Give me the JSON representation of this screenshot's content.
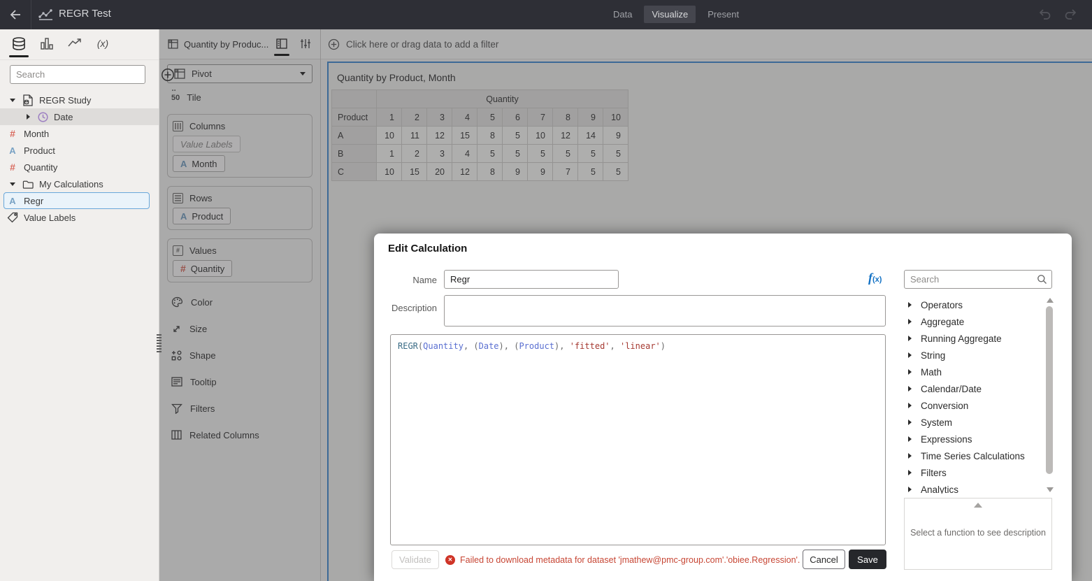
{
  "topbar": {
    "title": "REGR Test",
    "tabs": [
      {
        "label": "Data"
      },
      {
        "label": "Visualize"
      },
      {
        "label": "Present"
      }
    ],
    "icons": [
      "back-arrow",
      "workbook-chart",
      "undo",
      "redo"
    ]
  },
  "data_panel": {
    "nav_icons": [
      "data",
      "visualizations",
      "analytics",
      "calculations-fx"
    ],
    "search_placeholder": "Search",
    "add_icon": "circled-plus",
    "tree": [
      {
        "label": "REGR Study",
        "icon": "dataset",
        "level": 0,
        "expanded": true
      },
      {
        "label": "Date",
        "icon": "clock-date",
        "level": 1,
        "collapsed": true,
        "highlighted": true
      },
      {
        "label": "Month",
        "icon": "number-attribute",
        "level": 1
      },
      {
        "label": "Product",
        "icon": "text-attribute",
        "level": 1
      },
      {
        "label": "Quantity",
        "icon": "number-attribute",
        "level": 1
      },
      {
        "label": "My Calculations",
        "icon": "folder",
        "level": 0,
        "expanded": true
      },
      {
        "label": "Regr",
        "icon": "text-attribute",
        "level": 1,
        "selected": true
      },
      {
        "label": "Value Labels",
        "icon": "tag",
        "level": 0
      }
    ]
  },
  "grammar_panel": {
    "tab_label": "Quantity by Produc...",
    "tab_icons": [
      "pivot-grid",
      "grammar-panel",
      "properties-sliders"
    ],
    "viz_type_label": "Pivot",
    "tile_label": "Tile",
    "sections": [
      {
        "label": "Columns",
        "pills": [
          {
            "label": "Value Labels",
            "placeholder": true
          },
          {
            "label": "Month",
            "glyph": "A"
          }
        ]
      },
      {
        "label": "Rows",
        "pills": [
          {
            "label": "Product",
            "glyph": "A"
          }
        ]
      },
      {
        "label": "Values",
        "pills": [
          {
            "label": "Quantity",
            "glyph": "#"
          }
        ]
      }
    ],
    "extras": [
      "Color",
      "Size",
      "Shape",
      "Tooltip",
      "Filters",
      "Related Columns"
    ]
  },
  "canvas": {
    "filter_prompt": "Click here or drag data to add a filter",
    "viz_title": "Quantity by Product, Month",
    "table": {
      "group_header": "Quantity",
      "row_header": "Product",
      "columns": [
        "1",
        "2",
        "3",
        "4",
        "5",
        "6",
        "7",
        "8",
        "9",
        "10"
      ],
      "rows": [
        {
          "label": "A",
          "values": [
            10,
            11,
            12,
            15,
            8,
            5,
            10,
            12,
            14,
            9
          ]
        },
        {
          "label": "B",
          "values": [
            1,
            2,
            3,
            4,
            5,
            5,
            5,
            5,
            5,
            5
          ]
        },
        {
          "label": "C",
          "values": [
            10,
            15,
            20,
            12,
            8,
            9,
            9,
            7,
            5,
            5
          ]
        }
      ]
    }
  },
  "dialog": {
    "title": "Edit Calculation",
    "name_label": "Name",
    "name_value": "Regr",
    "description_label": "Description",
    "description_value": "",
    "fx_icon": "f(x)",
    "formula_tokens": [
      {
        "text": "REGR",
        "type": "function"
      },
      {
        "text": "(",
        "type": "punct"
      },
      {
        "text": "Quantity",
        "type": "column"
      },
      {
        "text": ", ",
        "type": "punct"
      },
      {
        "text": "(",
        "type": "punct"
      },
      {
        "text": "Date",
        "type": "column"
      },
      {
        "text": ")",
        "type": "punct"
      },
      {
        "text": ", ",
        "type": "punct"
      },
      {
        "text": "(",
        "type": "punct"
      },
      {
        "text": "Product",
        "type": "column"
      },
      {
        "text": ")",
        "type": "punct"
      },
      {
        "text": ", ",
        "type": "punct"
      },
      {
        "text": "'fitted'",
        "type": "string"
      },
      {
        "text": ", ",
        "type": "punct"
      },
      {
        "text": "'linear'",
        "type": "string"
      },
      {
        "text": ")",
        "type": "punct"
      }
    ],
    "functions": {
      "search_placeholder": "Search",
      "categories": [
        "Operators",
        "Aggregate",
        "Running Aggregate",
        "String",
        "Math",
        "Calendar/Date",
        "Conversion",
        "System",
        "Expressions",
        "Time Series Calculations",
        "Filters",
        "Analytics"
      ],
      "description_placeholder": "Select a function to see description"
    },
    "validate_label": "Validate",
    "error_message": "Failed to download metadata for dataset 'jmathew@pmc-group.com'.'obiee.Regression'.",
    "cancel_label": "Cancel",
    "save_label": "Save"
  },
  "colors": {
    "topbar_bg": "#2e2f36",
    "selection_blue": "#4a8fd3",
    "error_red": "#c74634",
    "number_attr": "#d96b5f",
    "text_attr": "#79a2c4",
    "date_attr": "#9d7fc2",
    "token_function": "#3a6b85",
    "token_column": "#5a6fd1",
    "token_string": "#a63a32",
    "save_button_bg": "#26272b"
  }
}
